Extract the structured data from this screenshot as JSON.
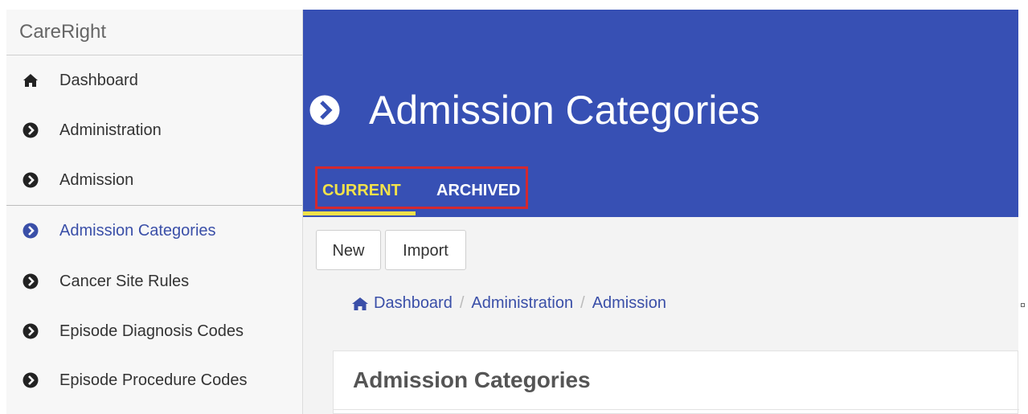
{
  "app": {
    "brand": "CareRight"
  },
  "sidebar": {
    "items": [
      {
        "label": "Dashboard",
        "icon": "home-icon"
      },
      {
        "label": "Administration",
        "icon": "chevron-circle-right-icon"
      },
      {
        "label": "Admission",
        "icon": "chevron-circle-right-icon"
      },
      {
        "label": "Admission Categories",
        "icon": "chevron-circle-right-icon",
        "active": true
      },
      {
        "label": "Cancer Site Rules",
        "icon": "chevron-circle-right-icon"
      },
      {
        "label": "Episode Diagnosis Codes",
        "icon": "chevron-circle-right-icon"
      },
      {
        "label": "Episode Procedure Codes",
        "icon": "chevron-circle-right-icon"
      }
    ]
  },
  "header": {
    "title": "Admission Categories",
    "tabs": [
      {
        "label": "CURRENT",
        "active": true
      },
      {
        "label": "ARCHIVED",
        "active": false
      }
    ]
  },
  "toolbar": {
    "new_label": "New",
    "import_label": "Import"
  },
  "breadcrumb": {
    "items": [
      {
        "label": "Dashboard"
      },
      {
        "label": "Administration"
      },
      {
        "label": "Admission"
      }
    ]
  },
  "panel": {
    "title": "Admission Categories"
  },
  "colors": {
    "header_bg": "#3750b4",
    "active_tab": "#f2e24a",
    "highlight_border": "#d4282f",
    "link": "#3a4fa8"
  }
}
